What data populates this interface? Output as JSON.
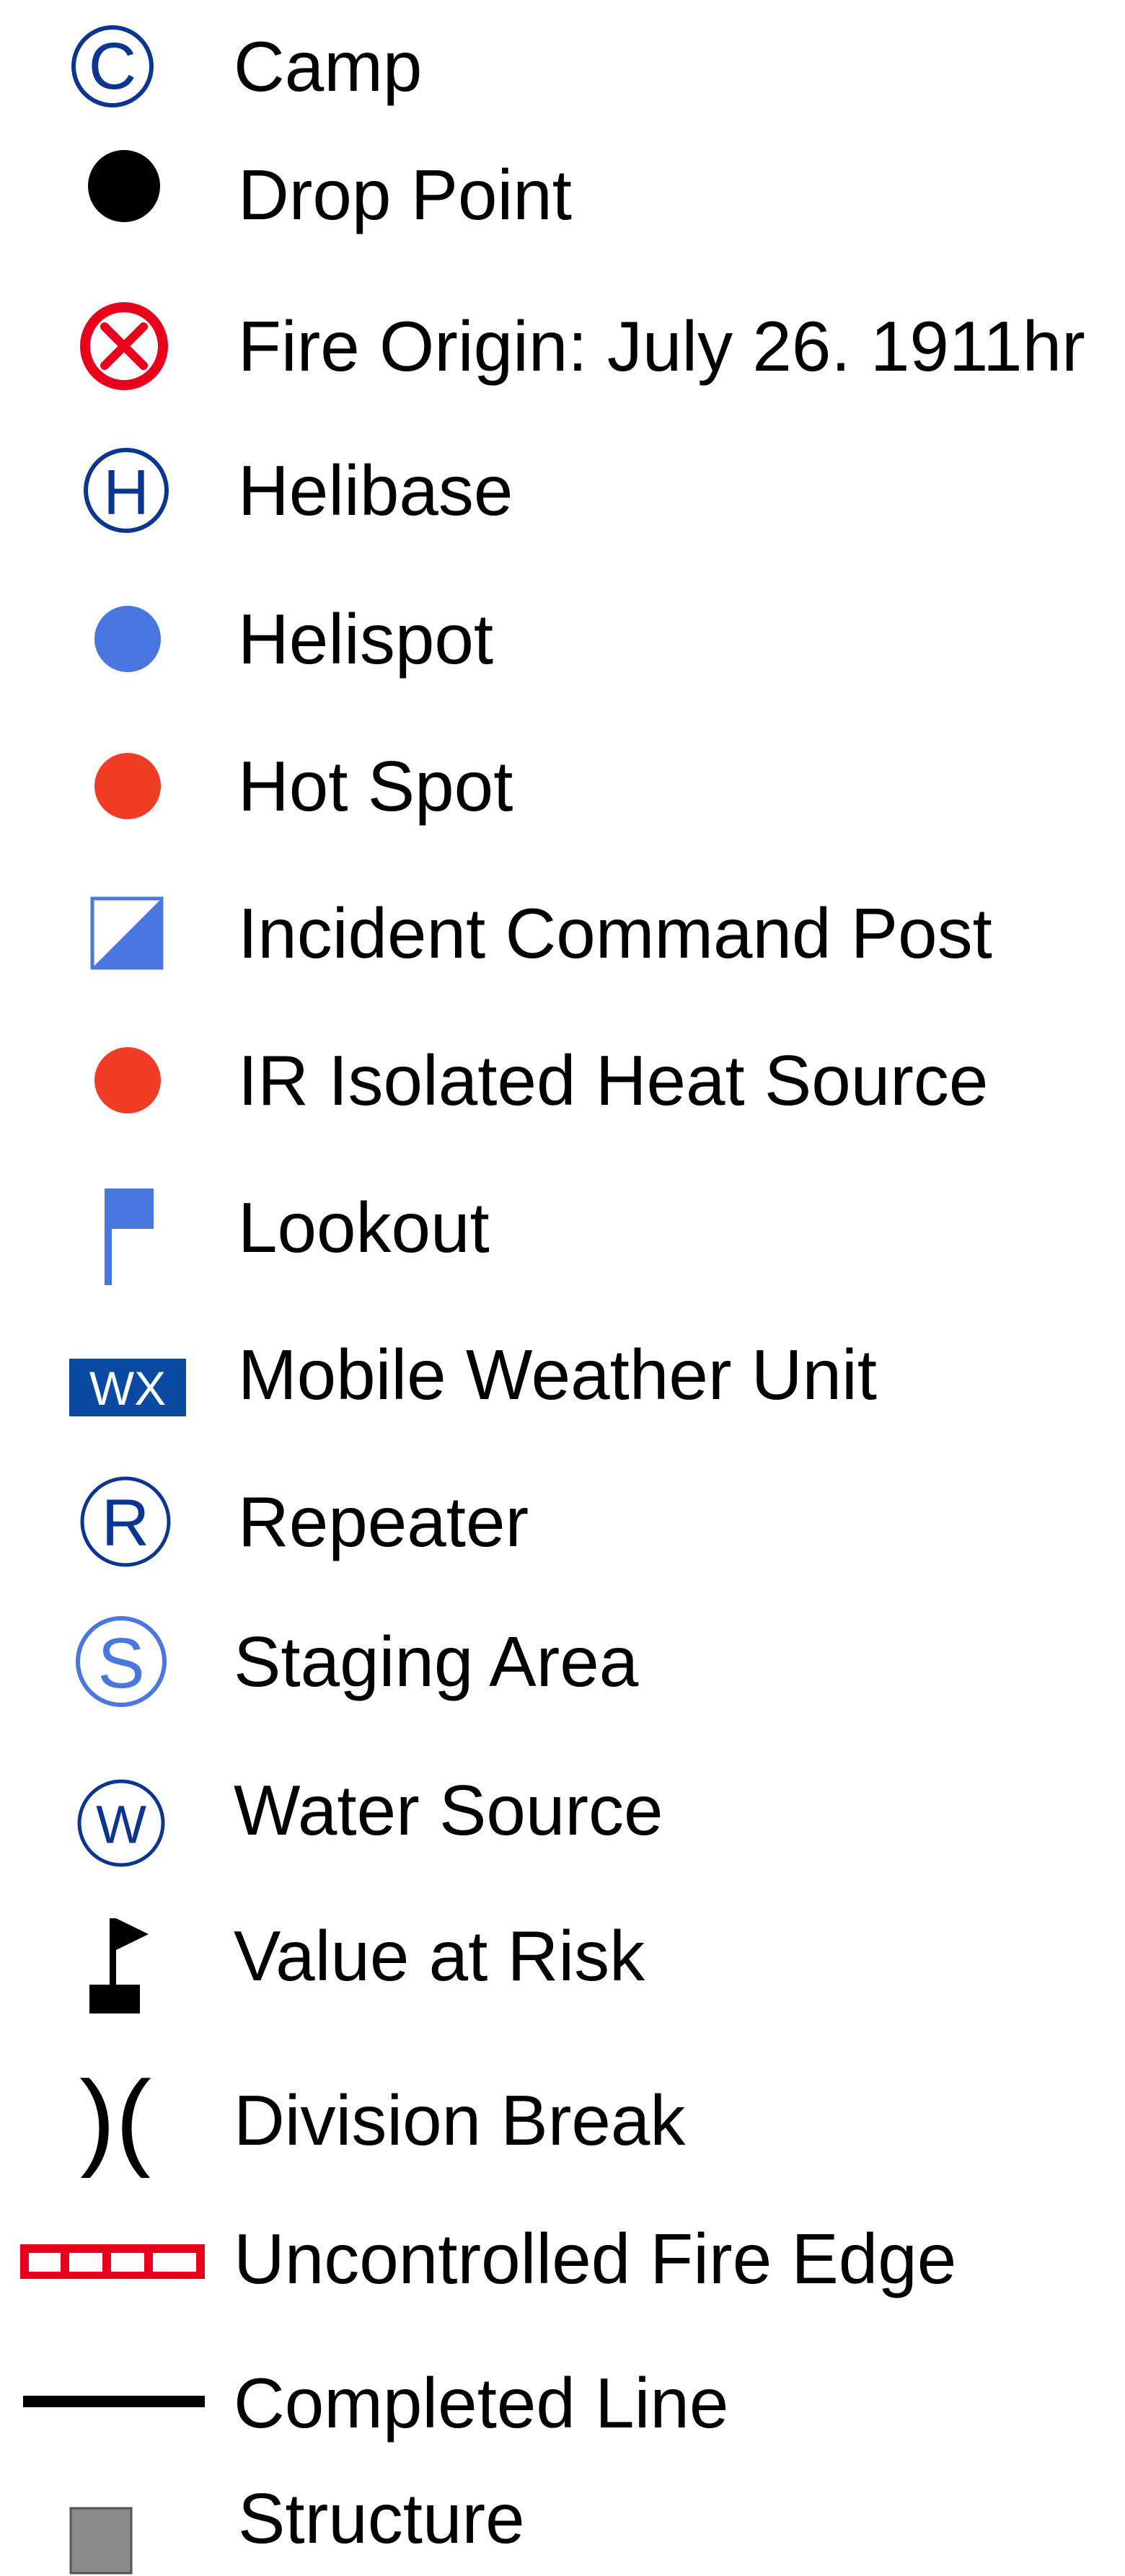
{
  "legend": {
    "colors": {
      "dark_blue": "#0a3591",
      "blue": "#4a76e0",
      "red_orange": "#f23d26",
      "red": "#e8001c",
      "wx_blue": "#0b4aa2",
      "gray": "#8a8a8a",
      "black": "#000000"
    },
    "items": [
      {
        "label": "Camp",
        "icon": "camp-icon"
      },
      {
        "label": "Drop Point",
        "icon": "drop-point-icon"
      },
      {
        "label": "Fire Origin: July 26. 1911hr",
        "icon": "fire-origin-icon"
      },
      {
        "label": "Helibase",
        "icon": "helibase-icon"
      },
      {
        "label": "Helispot",
        "icon": "helispot-icon"
      },
      {
        "label": "Hot Spot",
        "icon": "hot-spot-icon"
      },
      {
        "label": "Incident Command Post",
        "icon": "incident-command-post-icon"
      },
      {
        "label": "IR Isolated Heat Source",
        "icon": "ir-heat-source-icon"
      },
      {
        "label": "Lookout",
        "icon": "lookout-flag-icon"
      },
      {
        "label": "Mobile Weather Unit",
        "icon": "mobile-weather-unit-icon",
        "glyph": "WX"
      },
      {
        "label": "Repeater",
        "icon": "repeater-icon",
        "glyph": "R"
      },
      {
        "label": "Staging Area",
        "icon": "staging-area-icon",
        "glyph": "S"
      },
      {
        "label": "Water Source",
        "icon": "water-source-icon",
        "glyph": "W"
      },
      {
        "label": "Value at Risk",
        "icon": "value-at-risk-icon"
      },
      {
        "label": "Division Break",
        "icon": "division-break-icon",
        "glyph": ")("
      },
      {
        "label": "Uncontrolled Fire Edge",
        "icon": "uncontrolled-fire-edge-icon"
      },
      {
        "label": "Completed Line",
        "icon": "completed-line-icon"
      },
      {
        "label": "Structure",
        "icon": "structure-icon"
      }
    ],
    "camp_glyph": "C",
    "helibase_glyph": "H"
  }
}
